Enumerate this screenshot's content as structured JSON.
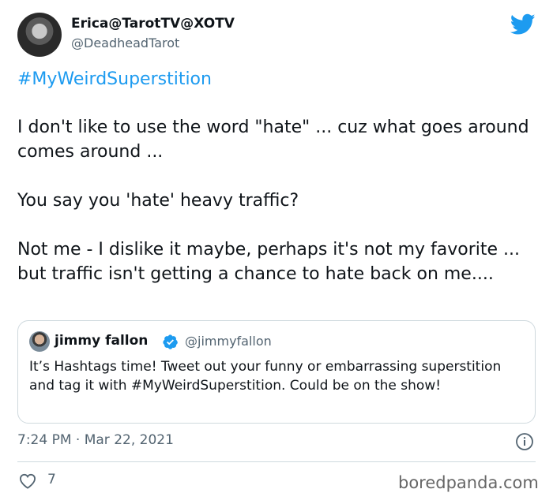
{
  "author": {
    "display_name": "Erica@TarotTV@XOTV",
    "handle": "@DeadheadTarot"
  },
  "tweet": {
    "hashtag": "#MyWeirdSuperstition",
    "paragraphs": [
      "I don't like to use the word \"hate\" ... cuz what goes around comes around ...",
      "You say you 'hate' heavy traffic?",
      "Not me - I dislike it maybe, perhaps it's not my favorite ... but traffic isn't getting a chance to hate back on me...."
    ]
  },
  "quoted_tweet": {
    "display_name": "jimmy fallon",
    "handle": "@jimmyfallon",
    "text": "It’s Hashtags time! Tweet out your funny or embarrassing superstition and tag it with #MyWeirdSuperstition. Could be on the show!"
  },
  "meta": {
    "timestamp": "7:24 PM · Mar 22, 2021",
    "like_count": "7"
  },
  "watermark": "boredpanda.com",
  "colors": {
    "twitter_blue": "#1d9bf0",
    "text_primary": "#0f1419",
    "text_secondary": "#536471",
    "border": "#cfd9de"
  },
  "icons": [
    "twitter-logo-icon",
    "verified-badge-icon",
    "info-icon",
    "heart-icon"
  ]
}
